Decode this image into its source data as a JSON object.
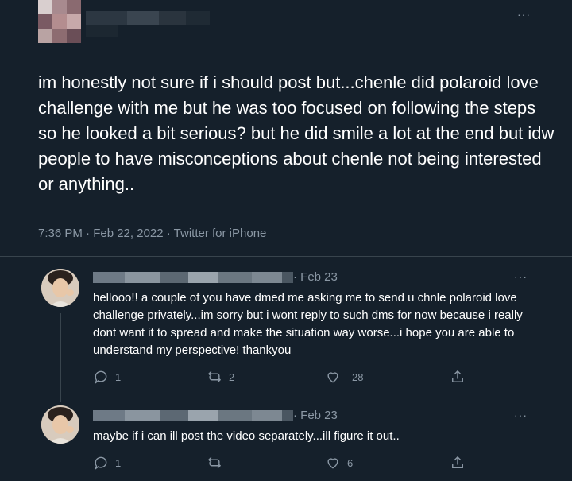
{
  "main_tweet": {
    "text": "im honestly not sure if i should post but...chenle did polaroid love challenge with me but he was too focused on following the steps so he looked a bit serious? but he did smile a lot at the end but idw people to have misconceptions about chenle not being interested or anything..",
    "timestamp": "7:36 PM · Feb 22, 2022 · Twitter for iPhone",
    "more_label": "···"
  },
  "replies": [
    {
      "date": "· Feb 23",
      "more_label": "···",
      "text": "hellooo!! a couple of you have dmed me asking me to send u chnle polaroid love challenge privately...im sorry but i wont reply to such dms for now because i really dont want it to spread and make the situation way worse...i hope you are able to understand my perspective! thankyou",
      "actions": {
        "reply_count": "1",
        "retweet_count": "2",
        "like_count": "28"
      }
    },
    {
      "date": "· Feb 23",
      "more_label": "···",
      "text": "maybe if i can ill post the video separately...ill figure it out..",
      "actions": {
        "reply_count": "1",
        "retweet_count": "",
        "like_count": "6"
      }
    }
  ],
  "colors": {
    "background": "#15202b",
    "text": "#ffffff",
    "secondary_text": "#8b98a5",
    "divider": "#38444d"
  },
  "icons": {
    "reply": "comment-bubble-icon",
    "retweet": "retweet-icon",
    "like": "heart-icon",
    "share": "share-icon",
    "more": "more-dots-icon"
  }
}
